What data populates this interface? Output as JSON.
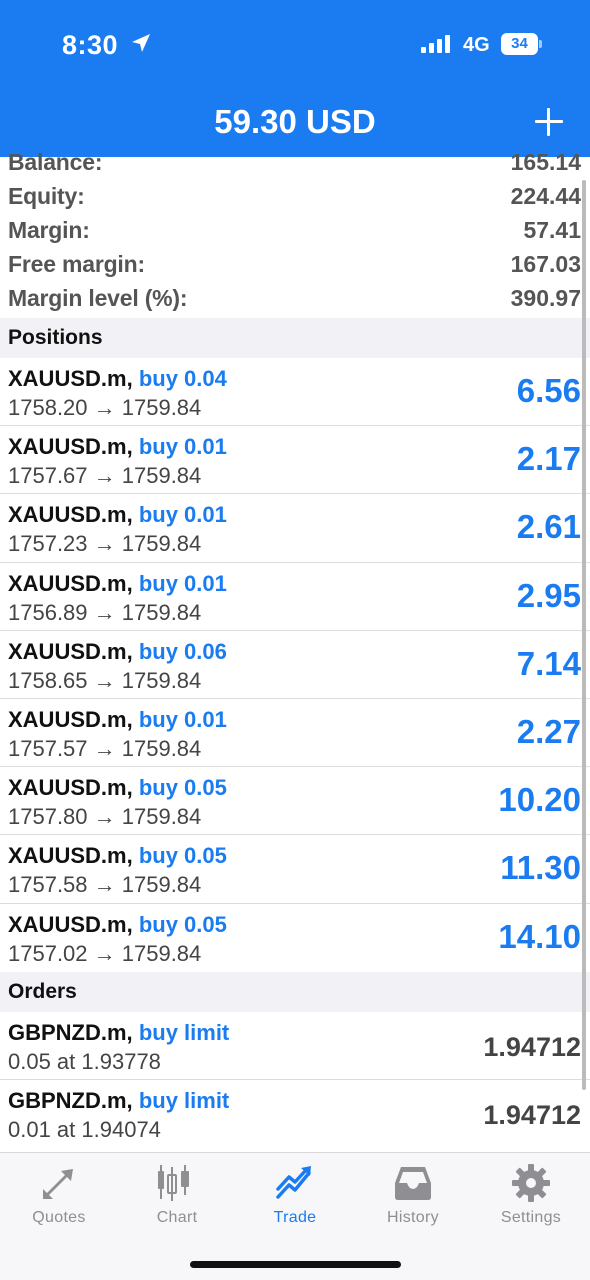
{
  "status_bar": {
    "time": "8:30",
    "network": "4G",
    "battery": "34"
  },
  "header": {
    "title": "59.30 USD"
  },
  "summary": [
    {
      "label": "Balance:",
      "value": "165.14"
    },
    {
      "label": "Equity:",
      "value": "224.44"
    },
    {
      "label": "Margin:",
      "value": "57.41"
    },
    {
      "label": "Free margin:",
      "value": "167.03"
    },
    {
      "label": "Margin level (%):",
      "value": "390.97"
    }
  ],
  "positions_header": "Positions",
  "positions": [
    {
      "symbol": "XAUUSD.m,",
      "side": "buy 0.04",
      "prices": "1758.20 → 1759.84",
      "profit": "6.56"
    },
    {
      "symbol": "XAUUSD.m,",
      "side": "buy 0.01",
      "prices": "1757.67 → 1759.84",
      "profit": "2.17"
    },
    {
      "symbol": "XAUUSD.m,",
      "side": "buy 0.01",
      "prices": "1757.23 → 1759.84",
      "profit": "2.61"
    },
    {
      "symbol": "XAUUSD.m,",
      "side": "buy 0.01",
      "prices": "1756.89 → 1759.84",
      "profit": "2.95"
    },
    {
      "symbol": "XAUUSD.m,",
      "side": "buy 0.06",
      "prices": "1758.65 → 1759.84",
      "profit": "7.14"
    },
    {
      "symbol": "XAUUSD.m,",
      "side": "buy 0.01",
      "prices": "1757.57 → 1759.84",
      "profit": "2.27"
    },
    {
      "symbol": "XAUUSD.m,",
      "side": "buy 0.05",
      "prices": "1757.80 → 1759.84",
      "profit": "10.20"
    },
    {
      "symbol": "XAUUSD.m,",
      "side": "buy 0.05",
      "prices": "1757.58 → 1759.84",
      "profit": "11.30"
    },
    {
      "symbol": "XAUUSD.m,",
      "side": "buy 0.05",
      "prices": "1757.02 → 1759.84",
      "profit": "14.10"
    }
  ],
  "orders_header": "Orders",
  "orders": [
    {
      "symbol": "GBPNZD.m,",
      "side": "buy limit",
      "detail": "0.05 at 1.93778",
      "price": "1.94712"
    },
    {
      "symbol": "GBPNZD.m,",
      "side": "buy limit",
      "detail": "0.01 at 1.94074",
      "price": "1.94712"
    }
  ],
  "tabs": [
    {
      "label": "Quotes",
      "icon": "quotes-arrows-icon"
    },
    {
      "label": "Chart",
      "icon": "candlestick-chart-icon"
    },
    {
      "label": "Trade",
      "icon": "trade-chart-icon",
      "active": true
    },
    {
      "label": "History",
      "icon": "inbox-tray-icon"
    },
    {
      "label": "Settings",
      "icon": "gear-icon"
    }
  ],
  "colors": {
    "accent": "#1a7cf0",
    "inactive": "#8e8e93"
  }
}
